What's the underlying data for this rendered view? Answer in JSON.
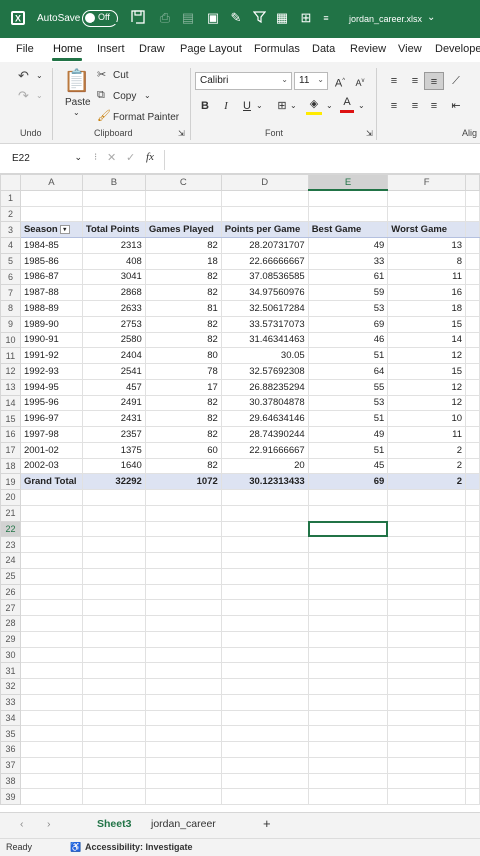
{
  "titlebar": {
    "autosave_label": "AutoSave",
    "autosave_state": "Off",
    "filename": "jordan_career.xlsx",
    "brand_color": "#217346"
  },
  "menu": {
    "tabs": [
      "File",
      "Home",
      "Insert",
      "Draw",
      "Page Layout",
      "Formulas",
      "Data",
      "Review",
      "View",
      "Develope"
    ],
    "active": "Home"
  },
  "ribbon": {
    "undo_group": "Undo",
    "clipboard_group": "Clipboard",
    "font_group": "Font",
    "align_group": "Alig",
    "paste": "Paste",
    "cut": "Cut",
    "copy": "Copy",
    "format_painter": "Format Painter",
    "font_name": "Calibri",
    "font_size": "11",
    "bold": "B",
    "italic": "I",
    "underline": "U"
  },
  "formula_bar": {
    "name_box": "E22",
    "fx": "fx",
    "formula": ""
  },
  "columns": [
    "A",
    "B",
    "C",
    "D",
    "E",
    "F"
  ],
  "selected_column": "E",
  "selected_row": "22",
  "table": {
    "headers": [
      "Season",
      "Total Points",
      "Games Played",
      "Points per Game",
      "Best Game",
      "Worst Game"
    ],
    "rows": [
      [
        "1984-85",
        "2313",
        "82",
        "28.20731707",
        "49",
        "13"
      ],
      [
        "1985-86",
        "408",
        "18",
        "22.66666667",
        "33",
        "8"
      ],
      [
        "1986-87",
        "3041",
        "82",
        "37.08536585",
        "61",
        "11"
      ],
      [
        "1987-88",
        "2868",
        "82",
        "34.97560976",
        "59",
        "16"
      ],
      [
        "1988-89",
        "2633",
        "81",
        "32.50617284",
        "53",
        "18"
      ],
      [
        "1989-90",
        "2753",
        "82",
        "33.57317073",
        "69",
        "15"
      ],
      [
        "1990-91",
        "2580",
        "82",
        "31.46341463",
        "46",
        "14"
      ],
      [
        "1991-92",
        "2404",
        "80",
        "30.05",
        "51",
        "12"
      ],
      [
        "1992-93",
        "2541",
        "78",
        "32.57692308",
        "64",
        "15"
      ],
      [
        "1994-95",
        "457",
        "17",
        "26.88235294",
        "55",
        "12"
      ],
      [
        "1995-96",
        "2491",
        "82",
        "30.37804878",
        "53",
        "12"
      ],
      [
        "1996-97",
        "2431",
        "82",
        "29.64634146",
        "51",
        "10"
      ],
      [
        "1997-98",
        "2357",
        "82",
        "28.74390244",
        "49",
        "11"
      ],
      [
        "2001-02",
        "1375",
        "60",
        "22.91666667",
        "51",
        "2"
      ],
      [
        "2002-03",
        "1640",
        "82",
        "20",
        "45",
        "2"
      ]
    ],
    "total": [
      "Grand Total",
      "32292",
      "1072",
      "30.12313433",
      "69",
      "2"
    ]
  },
  "sheets": {
    "tabs": [
      "Sheet3",
      "jordan_career"
    ],
    "active": "Sheet3",
    "add": "+"
  },
  "status": {
    "ready": "Ready",
    "accessibility": "Accessibility: Investigate"
  }
}
